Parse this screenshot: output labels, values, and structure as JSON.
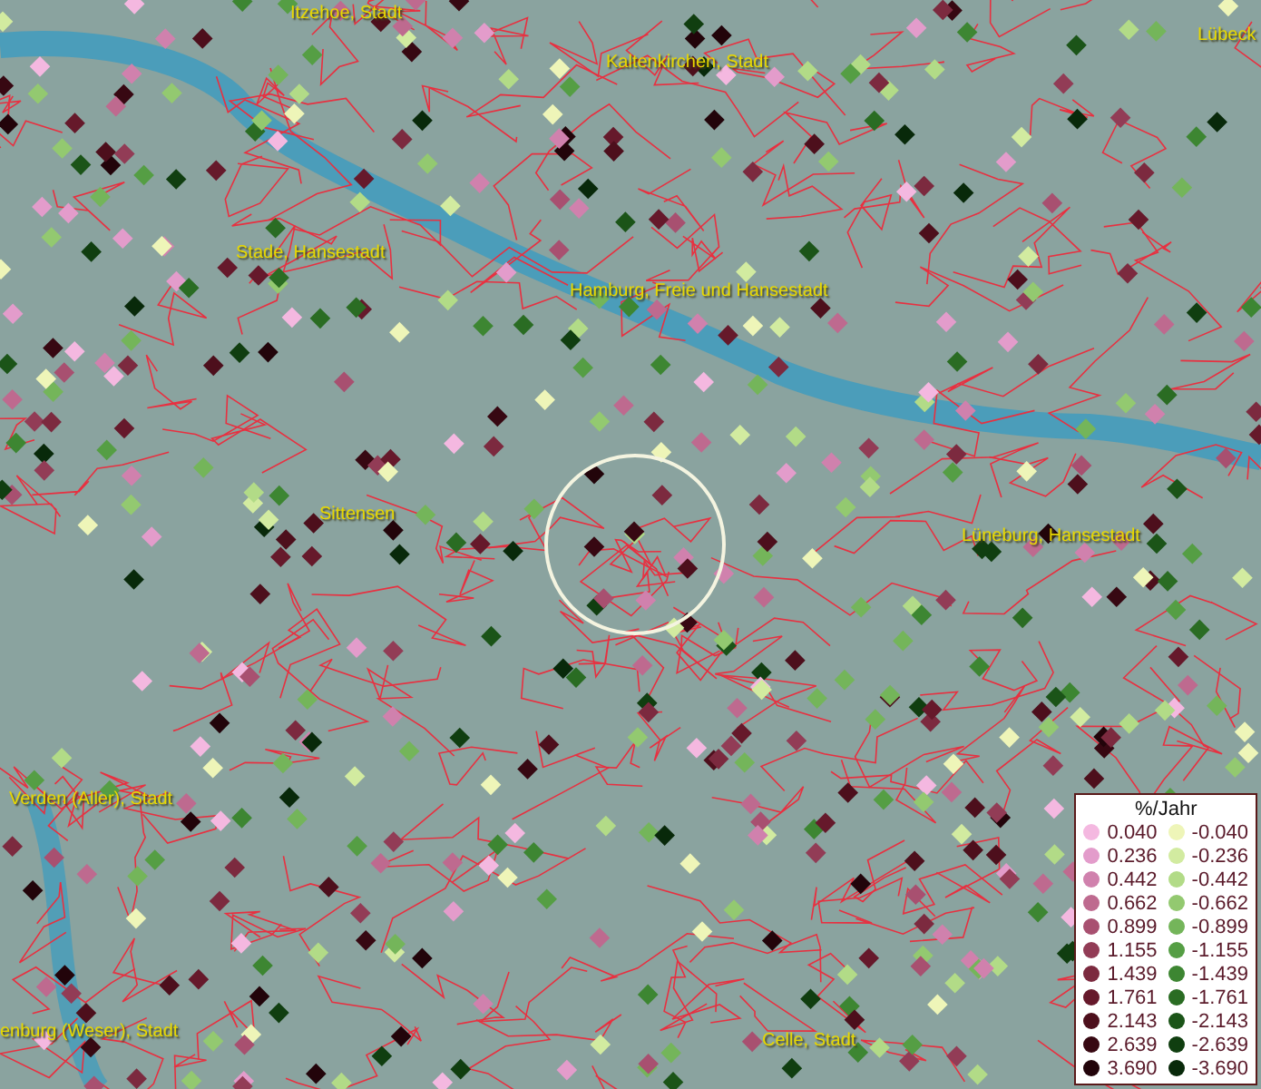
{
  "places": [
    {
      "name": "Itzehoe, Stadt"
    },
    {
      "name": "Kaltenkirchen, Stadt"
    },
    {
      "name": "Lübeck"
    },
    {
      "name": "Stade, Hansestadt"
    },
    {
      "name": "Hamburg, Freie und Hansestadt"
    },
    {
      "name": "Sittensen"
    },
    {
      "name": "Lüneburg, Hansestadt"
    },
    {
      "name": "Verden (Aller), Stadt"
    },
    {
      "name": "enburg (Weser), Stadt"
    },
    {
      "name": "Celle, Stadt"
    }
  ],
  "legend": {
    "title": "%/Jahr",
    "positive": [
      {
        "value": "0.040",
        "color": "#f4b8e0"
      },
      {
        "value": "0.236",
        "color": "#e39ccb"
      },
      {
        "value": "0.442",
        "color": "#d081ad"
      },
      {
        "value": "0.662",
        "color": "#be6a8f"
      },
      {
        "value": "0.899",
        "color": "#a85070"
      },
      {
        "value": "1.155",
        "color": "#923c56"
      },
      {
        "value": "1.439",
        "color": "#7c2a3f"
      },
      {
        "value": "1.761",
        "color": "#66192b"
      },
      {
        "value": "2.143",
        "color": "#4d0f1c"
      },
      {
        "value": "2.639",
        "color": "#370812"
      },
      {
        "value": "3.690",
        "color": "#22040a"
      }
    ],
    "negative": [
      {
        "value": "-0.040",
        "color": "#eef5b8"
      },
      {
        "value": "-0.236",
        "color": "#d2eba0"
      },
      {
        "value": "-0.442",
        "color": "#b2db87"
      },
      {
        "value": "-0.662",
        "color": "#93c970"
      },
      {
        "value": "-0.899",
        "color": "#74b55a"
      },
      {
        "value": "-1.155",
        "color": "#559e44"
      },
      {
        "value": "-1.439",
        "color": "#3d8632"
      },
      {
        "value": "-1.761",
        "color": "#2a6c23"
      },
      {
        "value": "-2.143",
        "color": "#1b5418"
      },
      {
        "value": "-2.639",
        "color": "#103e10"
      },
      {
        "value": "-3.690",
        "color": "#08290a"
      }
    ]
  }
}
